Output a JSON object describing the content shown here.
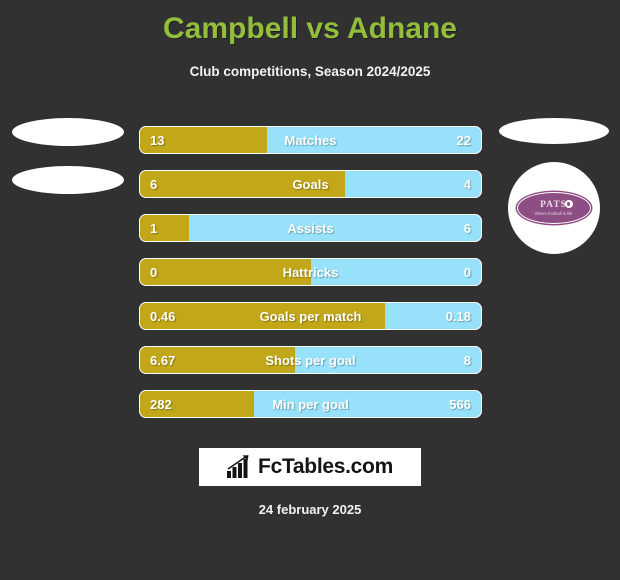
{
  "header": {
    "title": "Campbell vs Adnane",
    "subtitle": "Club competitions, Season 2024/2025",
    "title_color": "#93be3c",
    "subtitle_color": "#f2f2f2"
  },
  "theme": {
    "background": "#313131",
    "home_color": "#c2a718",
    "away_color": "#97e2fa",
    "bar_border": "#ffffff"
  },
  "players": {
    "home": {
      "name": "Campbell",
      "photo": "blank-photo-placeholder"
    },
    "away": {
      "name": "Adnane",
      "photo": "blank-photo-placeholder",
      "club_crest": "pats-club-crest"
    }
  },
  "crest": {
    "main_text": "PATS",
    "sub_text": "Where football is life",
    "badge_color": "#8d4f83"
  },
  "footer": {
    "logo_text": "FcTables.com",
    "logo_icon": "bar-chart-arrow-icon",
    "date": "24 february 2025"
  },
  "chart_data": {
    "type": "bar",
    "title": "Campbell vs Adnane",
    "subtitle": "Club competitions, Season 2024/2025",
    "orientation": "horizontal-diverging",
    "series": [
      {
        "name": "Campbell",
        "color": "#c2a718",
        "values": [
          13,
          6,
          1,
          0,
          0.46,
          6.67,
          282
        ]
      },
      {
        "name": "Adnane",
        "color": "#97e2fa",
        "values": [
          22,
          4,
          6,
          0,
          0.18,
          8,
          566
        ]
      }
    ],
    "categories": [
      "Matches",
      "Goals",
      "Assists",
      "Hattricks",
      "Goals per match",
      "Shots per goal",
      "Min per goal"
    ],
    "rows": [
      {
        "label": "Matches",
        "home": "13",
        "away": "22",
        "home_pct": 37.1
      },
      {
        "label": "Goals",
        "home": "6",
        "away": "4",
        "home_pct": 60.0
      },
      {
        "label": "Assists",
        "home": "1",
        "away": "6",
        "home_pct": 14.3
      },
      {
        "label": "Hattricks",
        "home": "0",
        "away": "0",
        "home_pct": 50.0
      },
      {
        "label": "Goals per match",
        "home": "0.46",
        "away": "0.18",
        "home_pct": 71.9
      },
      {
        "label": "Shots per goal",
        "home": "6.67",
        "away": "8",
        "home_pct": 45.5
      },
      {
        "label": "Min per goal",
        "home": "282",
        "away": "566",
        "home_pct": 33.3
      }
    ],
    "grid": false,
    "legend": "implicit-by-color",
    "xlabel": "",
    "ylabel": ""
  }
}
